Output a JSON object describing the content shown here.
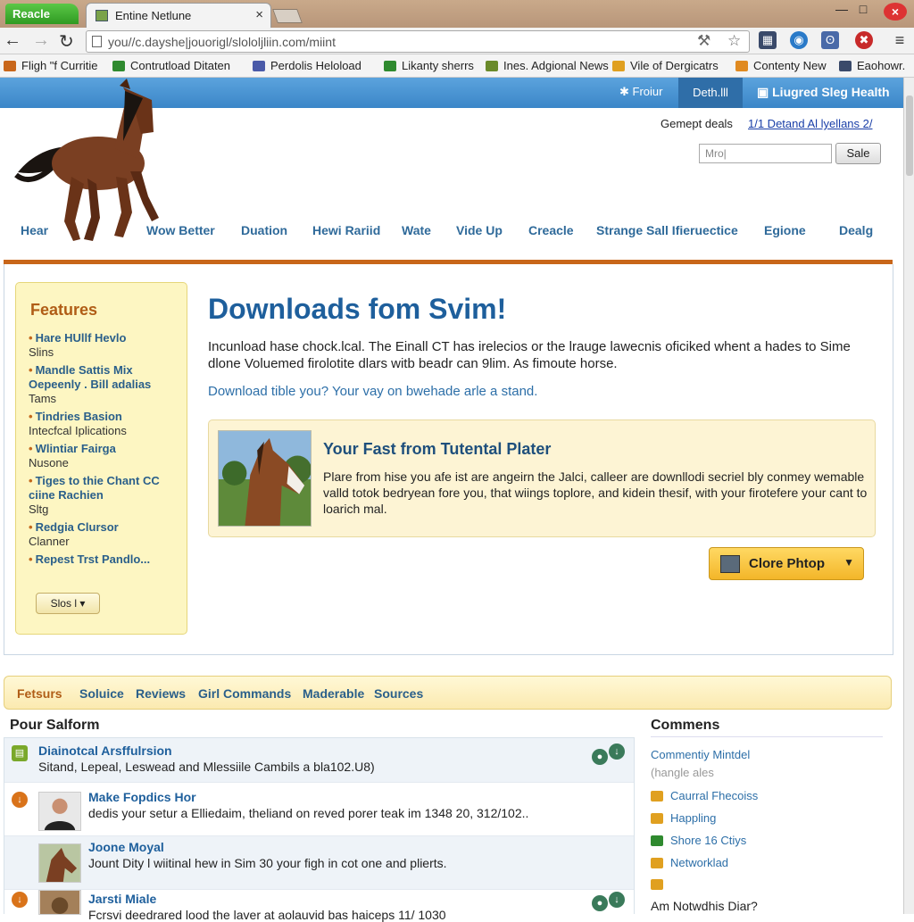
{
  "browser": {
    "green_button": "Reacle",
    "tab_title": "Entine Netlune",
    "tab_close": "×",
    "window_controls": [
      "—",
      "□"
    ],
    "window_close": "×",
    "url": "you//c.dayshe|jouorigl/slololjliin.com/miint",
    "bookmarks": [
      {
        "label": "Fligh \"f Curritie",
        "color": "#c8661a"
      },
      {
        "label": "Contrutload Ditaten",
        "color": "#2f8a2f"
      },
      {
        "label": "Perdolis Heloload",
        "color": "#4a5aa8"
      },
      {
        "label": "Likanty sherrs",
        "color": "#2f8a2f"
      },
      {
        "label": "Ines. Adgional News",
        "color": "#6a8a2a"
      },
      {
        "label": "Vile of Dergicatrs",
        "color": "#e0a020"
      },
      {
        "label": "Contenty New",
        "color": "#e08a20"
      },
      {
        "label": "Eaohowr.",
        "color": "#3a4a6a"
      }
    ]
  },
  "site_bar": {
    "item1": "✱ Froiur",
    "deal": "Deth.lll",
    "health": "Liugred Sleg Health"
  },
  "header": {
    "deals_label": "Gemept deals",
    "deals_link": "1/1 Detand Al lyellans 2/",
    "search_placeholder": "Mro|",
    "search_button": "Sale"
  },
  "main_nav": [
    "Hear",
    "Wow Better",
    "Duation",
    "Hewi Rariid",
    "Wate",
    "Vide Up",
    "Creacle",
    "Strange Sall Ifieruectice",
    "Egione",
    "Dealg"
  ],
  "features": {
    "title": "Features",
    "items": [
      {
        "main": "Hare HUllf Hevlo",
        "sub": "Slins"
      },
      {
        "main": "Mandle Sattis Mix Oepeenly . Bill adalias",
        "sub": "Tams"
      },
      {
        "main": "Tindries Basion",
        "sub": "Intecfcal Iplications"
      },
      {
        "main": "Wlintiar Fairga",
        "sub": "Nusone"
      },
      {
        "main": "Tiges to thie Chant CC ciine Rachien",
        "sub": "Sltg"
      },
      {
        "main": "Redgia Clursor",
        "sub": "Clanner"
      },
      {
        "main": "Repest Trst Pandlo...",
        "sub": ""
      }
    ],
    "button": "Slos l"
  },
  "hero": {
    "title": "Downloads fom Ѕvim!",
    "body": "Incunload hase chock.lcal. The Einall CT has irelecios or the lrauge lawecnis oficiked whent a hades to Sime dlone Voluemed firolotite dlars witb beadr can 9lim. As fimoute horse.",
    "link": "Download tible you? Your vay on bwehade arle a stand."
  },
  "promo": {
    "title": "Your Fast from Tutental Plater",
    "body": "Plare from hise you afe ist are angeirn the Jalci, calleer are downllodi secriel bly conmey wemable valld totok bedryean fore you, that wiings toplore, and kidein thesif, with your firotefere your cant to loarich mal."
  },
  "clone_button": "Clore Phtop",
  "section_tabs": [
    "Fetsurs",
    "Soluice",
    "Reviews",
    "Girl Commands",
    "Maderable",
    "Sources"
  ],
  "forum": {
    "title": "Pour Salform",
    "rows": [
      {
        "title": "Diainotcal Arsffulrsion",
        "body": "Sitand, Lepeal, Leswead and Mlessiile Cambils a bla102.U8)",
        "icon_color": "#7aa82a"
      },
      {
        "title": "Make Fopdics Hor",
        "body": "dedis your setur a Elliedaim, theliand on reved porer teak im 1348 20, 312/102..",
        "icon_color": "#d9731a"
      },
      {
        "title": "Joone Moyal",
        "body": "Jount Dity l wiitinal hew in Sim 30 your figh in cot one and plierts.",
        "icon_color": "#d9731a"
      },
      {
        "title": "Jarsti Miale",
        "body": "Fcrsvi deedrared lood the laver at aolauvid bas haiceps 11/ 1030",
        "icon_color": "#d9731a"
      }
    ]
  },
  "comments": {
    "title": "Commens",
    "items": [
      {
        "label": "Commentiy Mintdel",
        "color": ""
      },
      {
        "label": "Caurral Fhecoiss",
        "color": "#e0a020"
      },
      {
        "label": "Happling",
        "color": "#e0a020"
      },
      {
        "label": "Shore 16 Ctiys",
        "color": "#2f8a2f"
      },
      {
        "label": "Networklad",
        "color": "#e0a020"
      }
    ],
    "grey_note": "(hangle ales",
    "last": "Am Notwdhis Diar?"
  }
}
